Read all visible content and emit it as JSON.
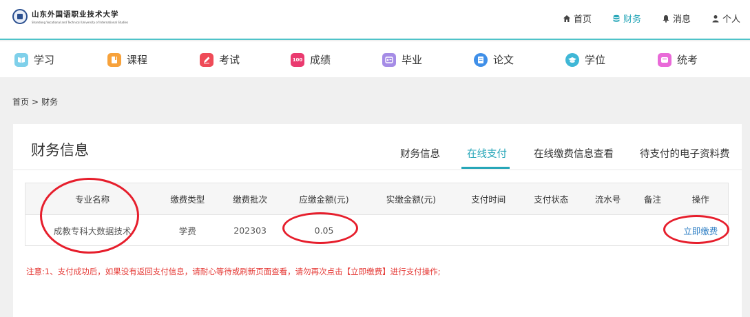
{
  "header": {
    "logo_cn": "山东外国语职业技术大学",
    "logo_en": "Shandong Vocational and Technical University of International Studies",
    "nav": [
      {
        "label": "首页",
        "icon": "home-icon",
        "active": false
      },
      {
        "label": "财务",
        "icon": "database-icon",
        "active": true
      },
      {
        "label": "消息",
        "icon": "bell-icon",
        "active": false
      },
      {
        "label": "个人",
        "icon": "user-icon",
        "active": false
      }
    ]
  },
  "modules": [
    {
      "label": "学习",
      "icon": "study-icon",
      "color": "#7fd0ea"
    },
    {
      "label": "课程",
      "icon": "course-icon",
      "color": "#f7a23b"
    },
    {
      "label": "考试",
      "icon": "exam-icon",
      "color": "#ef4b58"
    },
    {
      "label": "成绩",
      "icon": "score-icon",
      "color": "#ea3a6f"
    },
    {
      "label": "毕业",
      "icon": "graduation-icon",
      "color": "#a58ce6"
    },
    {
      "label": "论文",
      "icon": "thesis-icon",
      "color": "#3f8fe8"
    },
    {
      "label": "学位",
      "icon": "degree-icon",
      "color": "#3fb7d6"
    },
    {
      "label": "统考",
      "icon": "unified-exam-icon",
      "color": "#e96ad8"
    }
  ],
  "module_icon_texts": {
    "score": "100"
  },
  "breadcrumb": {
    "home": "首页",
    "sep": ">",
    "current": "财务"
  },
  "panel": {
    "title": "财务信息",
    "tabs": [
      {
        "label": "财务信息",
        "active": false
      },
      {
        "label": "在线支付",
        "active": true
      },
      {
        "label": "在线缴费信息查看",
        "active": false
      },
      {
        "label": "待支付的电子资料费",
        "active": false
      }
    ]
  },
  "table": {
    "headers": [
      "专业名称",
      "缴费类型",
      "缴费批次",
      "应缴金额(元)",
      "实缴金额(元)",
      "支付时间",
      "支付状态",
      "流水号",
      "备注",
      "操作"
    ],
    "rows": [
      {
        "major": "成教专科大数据技术",
        "type": "学费",
        "batch": "202303",
        "due": "0.05",
        "paid": "",
        "time": "",
        "status": "",
        "serial": "",
        "remark": "",
        "action": "立即缴费"
      }
    ]
  },
  "notice": "注意:1、支付成功后，如果没有返回支付信息，请耐心等待或刷新页面查看，请勿再次点击【立即缴费】进行支付操作;",
  "colors": {
    "accent": "#26a6b8",
    "link": "#2f7fc4",
    "notice": "#e53935",
    "annotation": "#e61e2c"
  }
}
